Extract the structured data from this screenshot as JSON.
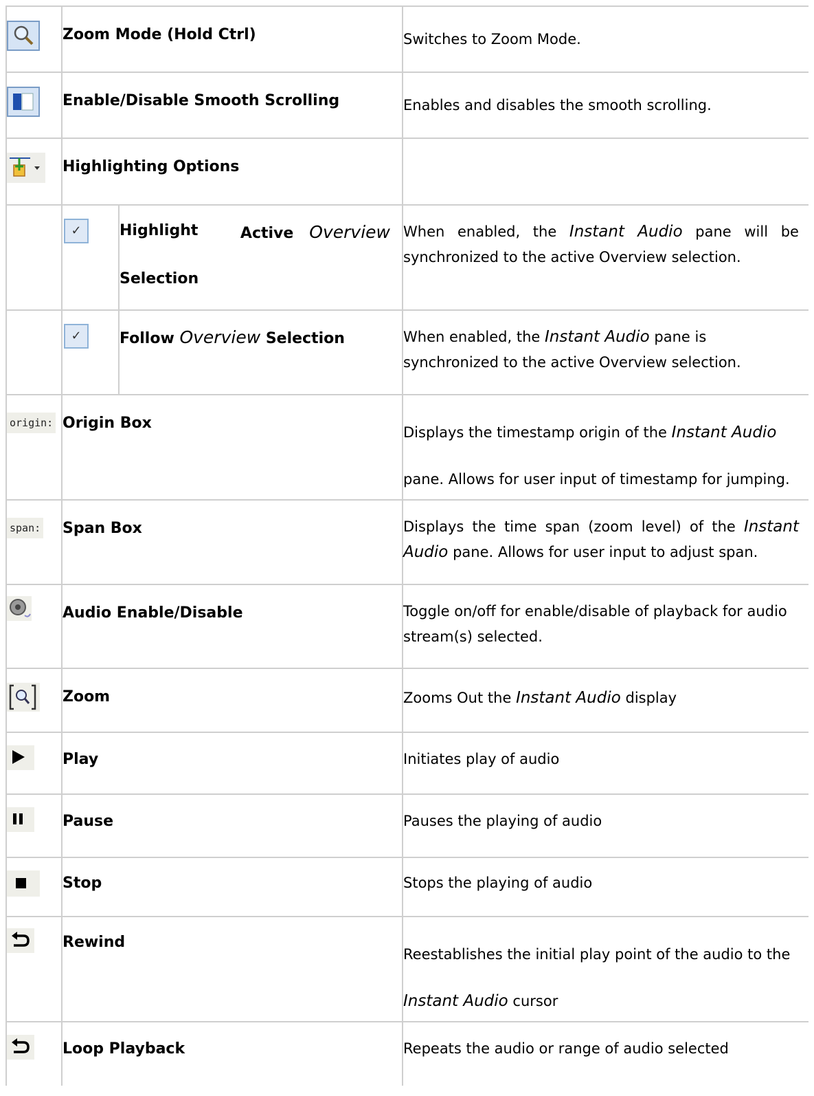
{
  "rows": [
    {
      "icon": "zoom-mode-icon",
      "name": "Zoom Mode (Hold Ctrl)",
      "desc": "Switches to Zoom Mode."
    },
    {
      "icon": "smooth-scroll-icon",
      "name": "Enable/Disable Smooth Scrolling",
      "desc": "Enables and disables the smooth scrolling."
    },
    {
      "icon": "highlight-options-icon",
      "name": "Highlighting Options",
      "desc": ""
    },
    {
      "icon": "checkbox-icon",
      "name_a": "Highlight",
      "name_b": "Active",
      "name_c": "Overview",
      "name_d": "Selection",
      "desc_a": "When enabled, the",
      "desc_b": "Instant Audio",
      "desc_c": "pane will be synchronized to the active Overview selection."
    },
    {
      "icon": "checkbox-icon",
      "name_a": "Follow",
      "name_b": "Overview",
      "name_c": "Selection",
      "desc_a": "When enabled, the",
      "desc_b": "Instant Audio",
      "desc_c": "pane is synchronized to the active Overview selection."
    },
    {
      "icon_text": "origin:",
      "name": "Origin Box",
      "desc_a": "Displays the timestamp origin of the",
      "desc_b": "Instant  Audio",
      "desc_c": "pane.  Allows for user input of timestamp for jumping."
    },
    {
      "icon_text": "span:",
      "name": "Span Box",
      "desc_a": "Displays the time span (zoom level) of the",
      "desc_b": "Instant Audio",
      "desc_c": "pane. Allows for user input to adjust span."
    },
    {
      "icon": "audio-toggle-icon",
      "name": "Audio Enable/Disable",
      "desc": "Toggle on/off for enable/disable of playback for audio stream(s) selected."
    },
    {
      "icon": "zoom-out-icon",
      "name": "Zoom",
      "desc_a": "Zooms Out the",
      "desc_b": "Instant Audio",
      "desc_c": "display"
    },
    {
      "icon": "play-icon",
      "name": "Play",
      "desc": "Initiates play of audio"
    },
    {
      "icon": "pause-icon",
      "name": "Pause",
      "desc": "Pauses the playing of audio"
    },
    {
      "icon": "stop-icon",
      "name": "Stop",
      "desc": "Stops the playing of audio"
    },
    {
      "icon": "rewind-icon",
      "name": "Rewind",
      "desc_a": "Reestablishes the initial play point of the audio to the",
      "desc_b": "Instant Audio",
      "desc_c": "cursor"
    },
    {
      "icon": "loop-icon",
      "name": "Loop Playback",
      "desc": "Repeats the audio or range of audio selected"
    }
  ]
}
